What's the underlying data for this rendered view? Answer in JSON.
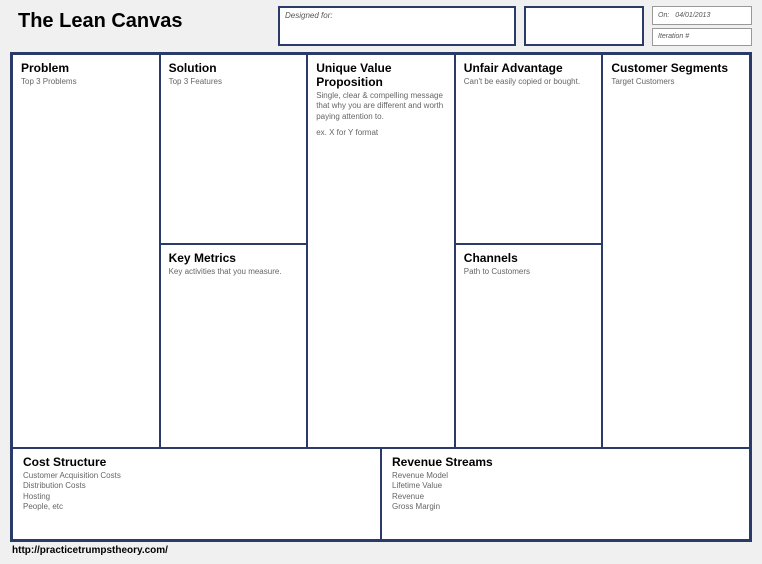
{
  "title": "The Lean Canvas",
  "header": {
    "designed_label": "Designed for:",
    "on_label": "On:",
    "on_value": "04/01/2013",
    "iteration_label": "Iteration #",
    "iteration_value": ""
  },
  "cells": {
    "problem": {
      "title": "Problem",
      "hint": "Top 3 Problems"
    },
    "solution": {
      "title": "Solution",
      "hint": "Top 3 Features"
    },
    "key_metrics": {
      "title": "Key Metrics",
      "hint": "Key activities that you measure."
    },
    "uvp": {
      "title": "Unique Value Proposition",
      "hint": "Single, clear & compelling message that why you are different and worth paying attention to.",
      "hint2": "ex. X for Y format"
    },
    "unfair": {
      "title": "Unfair Advantage",
      "hint": "Can't be easily copied or bought."
    },
    "channels": {
      "title": "Channels",
      "hint": "Path to Customers"
    },
    "segments": {
      "title": "Customer Segments",
      "hint": "Target Customers"
    },
    "cost": {
      "title": "Cost Structure",
      "hint": "Customer Acquisition Costs\nDistribution Costs\nHosting\nPeople, etc"
    },
    "revenue": {
      "title": "Revenue Streams",
      "hint": "Revenue Model\nLifetime Value\nRevenue\nGross Margin"
    }
  },
  "footer": "http://practicetrumpstheory.com/"
}
